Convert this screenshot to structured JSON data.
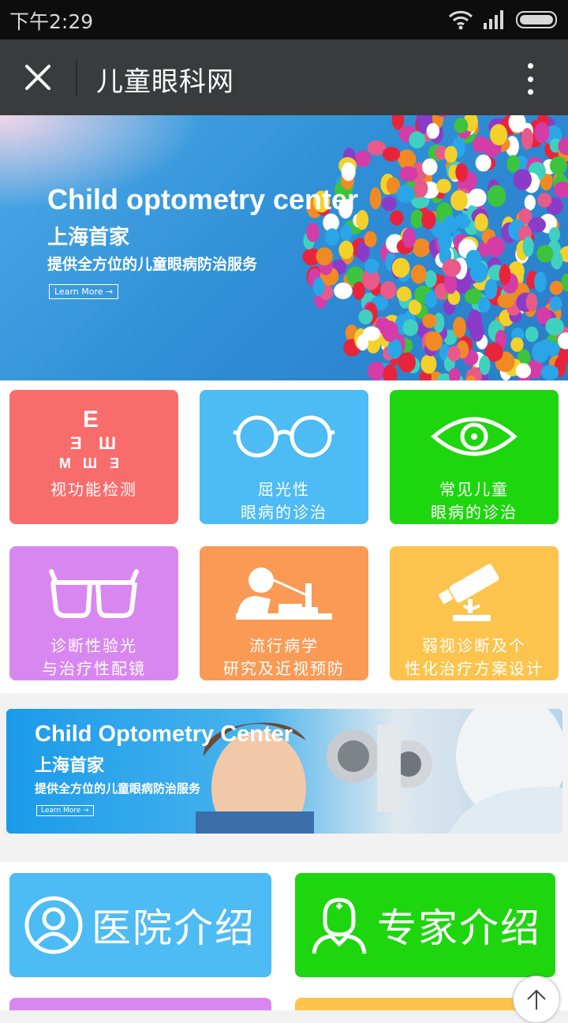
{
  "status_bar": {
    "time": "下午2:29"
  },
  "nav": {
    "title": "儿童眼科网"
  },
  "banner1": {
    "title": "Child optometry center",
    "subtitle": "上海首家",
    "desc": "提供全方位的儿童眼病防治服务",
    "button": "Learn More →"
  },
  "tiles": [
    {
      "label": "视功能检测",
      "color": "#f96c6c",
      "icon": "eye-chart-icon"
    },
    {
      "label": "屈光性\n眼病的诊治",
      "color": "#4dbbf4",
      "icon": "glasses-icon"
    },
    {
      "label": "常见儿童\n眼病的诊治",
      "color": "#1ed60e",
      "icon": "eye-icon"
    },
    {
      "label": "诊断性验光\n与治疗性配镜",
      "color": "#d987f0",
      "icon": "spectacles-icon"
    },
    {
      "label": "流行病学\n研究及近视预防",
      "color": "#fa9a55",
      "icon": "eye-exam-icon"
    },
    {
      "label": "弱视诊断及个\n性化治疗方案设计",
      "color": "#fcc44d",
      "icon": "microscope-icon"
    }
  ],
  "banner2": {
    "title": "Child Optometry Center",
    "subtitle": "上海首家",
    "desc": "提供全方位的儿童眼病防治服务",
    "button": "Learn More →"
  },
  "bottom_buttons": [
    {
      "label": "医院介绍",
      "color": "#4dbbf4",
      "icon": "user-circle-icon"
    },
    {
      "label": "专家介绍",
      "color": "#1ed60e",
      "icon": "doctor-icon"
    }
  ]
}
